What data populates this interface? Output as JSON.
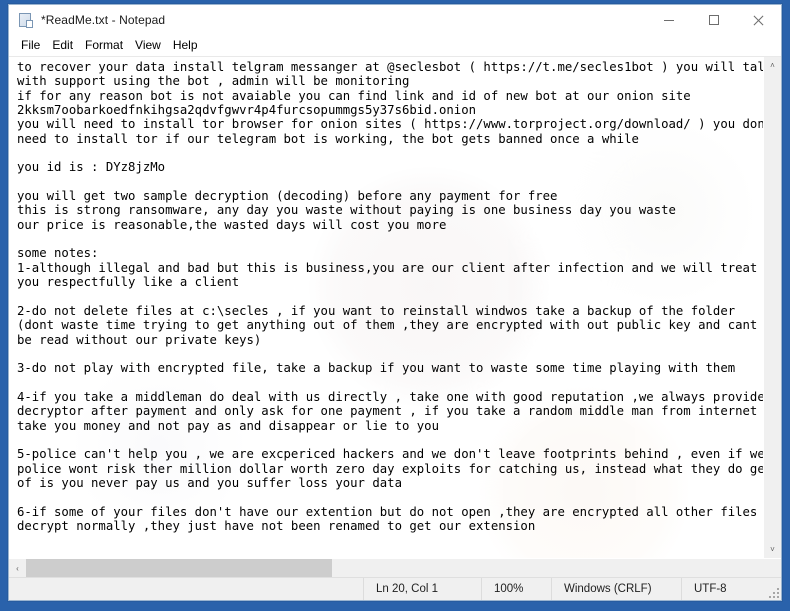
{
  "window": {
    "title": "*ReadMe.txt - Notepad",
    "icon": "notepad-document-icon",
    "controls": {
      "minimize": "—",
      "maximize": "□",
      "close": "✕"
    }
  },
  "menubar": {
    "items": [
      {
        "label": "File"
      },
      {
        "label": "Edit"
      },
      {
        "label": "Format"
      },
      {
        "label": "View"
      },
      {
        "label": "Help"
      }
    ]
  },
  "editor": {
    "content": "to recover your data install telgram messanger at @seclesbot ( https://t.me/secles1bot ) you will talk\nwith support using the bot , admin will be monitoring\nif for any reason bot is not avaiable you can find link and id of new bot at our onion site\n2kksm7oobarkoedfnkihgsa2qdvfgwvr4p4furcsopummgs5y37s6bid.onion\nyou will need to install tor browser for onion sites ( https://www.torproject.org/download/ ) you dont\nneed to install tor if our telegram bot is working, the bot gets banned once a while\n\nyou id is : DYz8jzMo\n\nyou will get two sample decryption (decoding) before any payment for free\nthis is strong ransomware, any day you waste without paying is one business day you waste\nour price is reasonable,the wasted days will cost you more\n\nsome notes:\n1-although illegal and bad but this is business,you are our client after infection and we will treat\nyou respectfully like a client\n\n2-do not delete files at c:\\secles , if you want to reinstall windwos take a backup of the folder\n(dont waste time trying to get anything out of them ,they are encrypted with out public key and cant\nbe read without our private keys)\n\n3-do not play with encrypted file, take a backup if you want to waste some time playing with them\n\n4-if you take a middleman do deal with us directly , take one with good reputation ,we always provide\ndecryptor after payment and only ask for one payment , if you take a random middle man from internet he may\ntake you money and not pay as and disappear or lie to you\n\n5-police can't help you , we are excpericed hackers and we don't leave footprints behind , even if we did\npolice wont risk ther million dollar worth zero day exploits for catching us, instead what they do get sure\nof is you never pay us and you suffer loss your data\n\n6-if some of your files don't have our extention but do not open ,they are encrypted all other files and will\ndecrypt normally ,they just have not been renamed to get our extension\n",
    "vertical_scrollbar": {
      "up_arrow": "˄",
      "down_arrow": "˅"
    },
    "horizontal_scrollbar": {
      "left_arrow": "‹",
      "right_arrow": "›"
    }
  },
  "statusbar": {
    "cursor_position": "Ln 20, Col 1",
    "zoom": "100%",
    "line_ending": "Windows (CRLF)",
    "encoding": "UTF-8"
  },
  "colors": {
    "desktop": "#2a62ab",
    "window_bg": "#ffffff",
    "titlebar_bg": "#ffffff",
    "statusbar_bg": "#f0f0f0",
    "text": "#000000",
    "scrollbar_thumb": "#cdcdcd"
  }
}
